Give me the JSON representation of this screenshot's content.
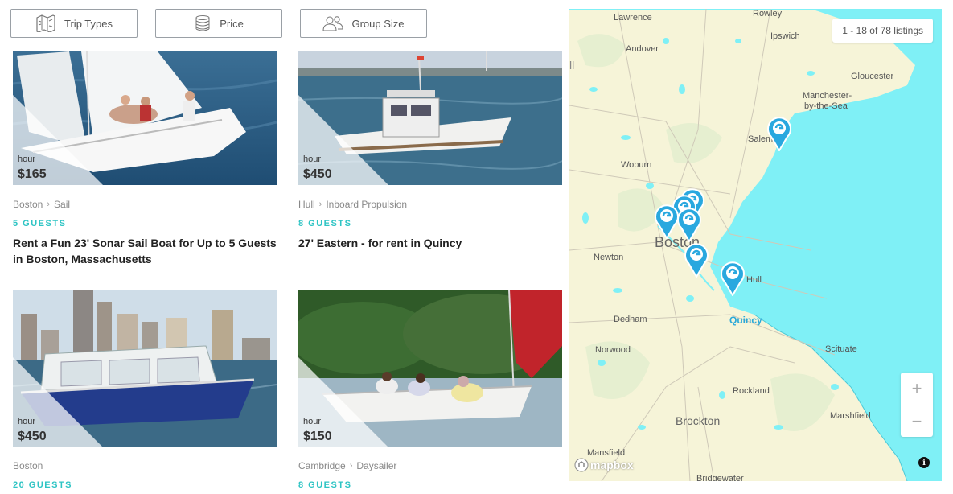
{
  "filters": [
    {
      "label": "Trip Types",
      "icon": "map-icon"
    },
    {
      "label": "Price",
      "icon": "coins-icon"
    },
    {
      "label": "Group Size",
      "icon": "people-icon"
    }
  ],
  "listings": [
    {
      "price_unit": "hour",
      "price": "$165",
      "location": "Boston",
      "type": "Sail",
      "guests": "5 GUESTS",
      "title": "Rent a Fun 23' Sonar Sail Boat for Up to 5 Guests in Boston, Massachusetts"
    },
    {
      "price_unit": "hour",
      "price": "$450",
      "location": "Hull",
      "type": "Inboard Propulsion",
      "guests": "8 GUESTS",
      "title": "27' Eastern - for rent in Quincy"
    },
    {
      "price_unit": "hour",
      "price": "$450",
      "location": "Boston",
      "type": "",
      "guests": "20 GUESTS",
      "title": ""
    },
    {
      "price_unit": "hour",
      "price": "$150",
      "location": "Cambridge",
      "type": "Daysailer",
      "guests": "8 GUESTS",
      "title": ""
    }
  ],
  "map": {
    "listing_count": "1 - 18 of 78 listings",
    "attribution": "mapbox",
    "places": [
      "Lawrence",
      "Rowley",
      "Ipswich",
      "Andover",
      "Gloucester",
      "Manchester-",
      "by-the-Sea",
      "Salem",
      "Woburn",
      "Boston",
      "Newton",
      "Hull",
      "Quincy",
      "Dedham",
      "Norwood",
      "Scituate",
      "Rockland",
      "Brockton",
      "Marshfield",
      "Mansfield",
      "Bridgewater",
      "ll"
    ],
    "zoom_in": "+",
    "zoom_out": "−",
    "info": "i",
    "water_color": "#7ff0f6",
    "land_color": "#f6f4d8",
    "pin_color": "#29a8df"
  }
}
